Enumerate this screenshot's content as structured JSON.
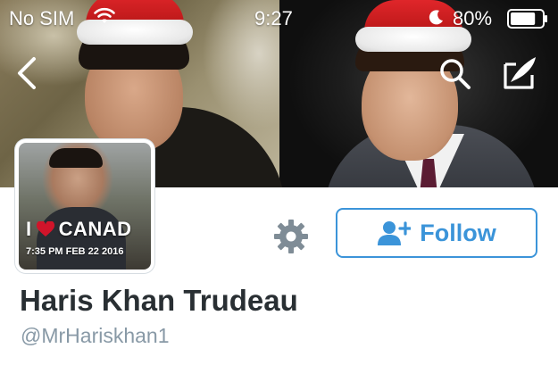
{
  "status_bar": {
    "carrier": "No SIM",
    "time": "9:27",
    "battery_percent": "80%",
    "battery_level": 0.8,
    "icons": [
      "wifi-icon",
      "moon-icon",
      "battery-icon"
    ]
  },
  "nav": {
    "icons": [
      "chevron-left-icon",
      "search-icon",
      "compose-icon"
    ]
  },
  "profile": {
    "avatar_caption_start": "I",
    "avatar_caption_end": "CANAD",
    "avatar_stamp": "7:35 PM FEB 22 2016",
    "display_name": "Haris Khan Trudeau",
    "handle": "@MrHariskhan1",
    "follow_label": "Follow",
    "icons": [
      "gear-icon",
      "add-user-icon",
      "heart-icon"
    ]
  },
  "colors": {
    "accent": "#3b94d9",
    "name_text": "#292f33",
    "handle_text": "#8899a6"
  }
}
